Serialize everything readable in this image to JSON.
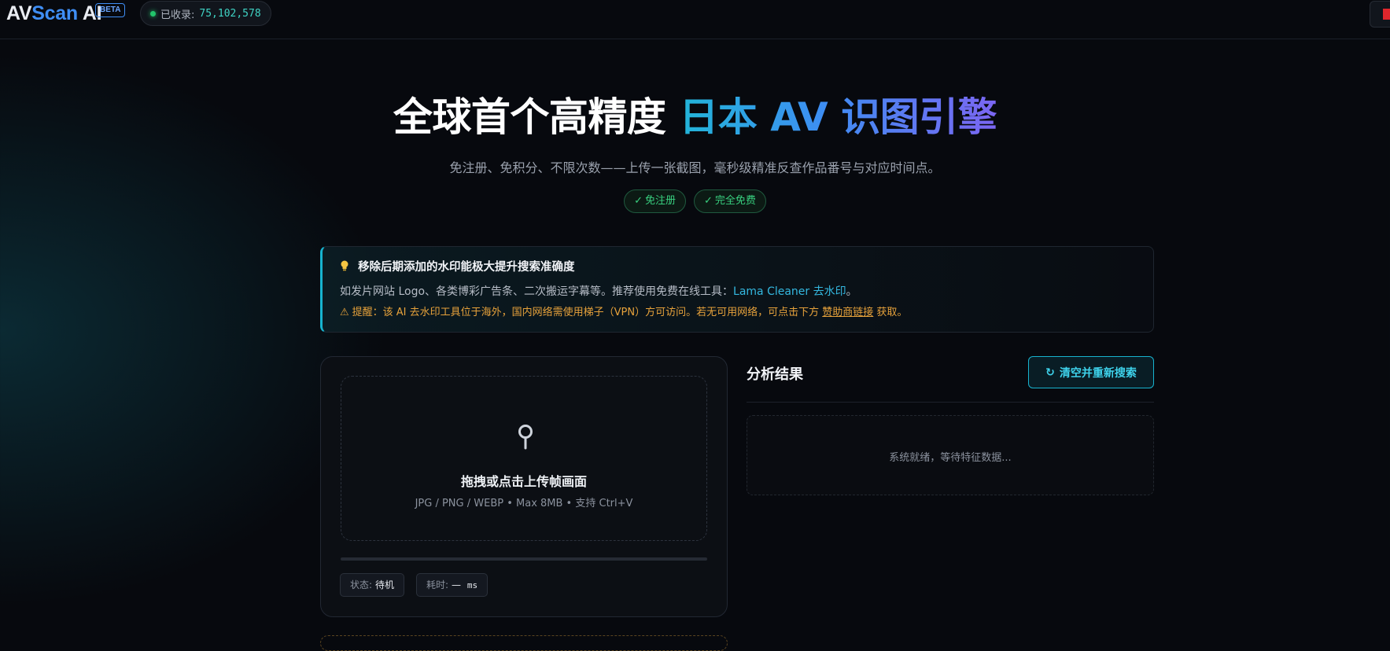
{
  "header": {
    "logo_part1": "AV",
    "logo_part2": "Scan",
    "logo_part3": "AI",
    "beta_badge": "BETA",
    "counter_label": "已收录:",
    "counter_value": "75,102,578",
    "counter_status_color": "#22c56b"
  },
  "hero": {
    "title_plain": "全球首个高精度",
    "title_highlight": "日本 AV 识图引擎",
    "subtitle": "免注册、免积分、不限次数——上传一张截图，毫秒级精准反查作品番号与对应时间点。",
    "pills": [
      {
        "check": "✓",
        "label": "免注册"
      },
      {
        "check": "✓",
        "label": "完全免费"
      }
    ]
  },
  "notice": {
    "title": "移除后期添加的水印能极大提升搜索准确度",
    "line2_text": "如发片网站 Logo、各类博彩广告条、二次搬运字幕等。推荐使用免费在线工具：",
    "line2_link": "Lama Cleaner 去水印",
    "line2_end": "。",
    "warning_icon": "⚠",
    "line3_text": "提醒：该 AI 去水印工具位于海外，国内网络需使用梯子（VPN）方可访问。若无可用网络，可点击下方",
    "line3_link": "赞助商链接",
    "line3_end": "获取。"
  },
  "upload": {
    "icon": "magnifier-icon",
    "title": "拖拽或点击上传帧画面",
    "formats": "JPG / PNG / WEBP • Max 8MB • 支持 Ctrl+V",
    "progress": 0,
    "status_label": "状态:",
    "status_value": "待机",
    "time_label": "耗时:",
    "time_value": "—",
    "time_unit": "ms"
  },
  "results": {
    "title": "分析结果",
    "clear_button_icon": "↻",
    "clear_button": "清空并重新搜索",
    "placeholder": "系统就绪，等待特征数据..."
  },
  "colors": {
    "accent": "#17b3cf",
    "brand_blue": "#3f8ef4",
    "success": "#38d07f",
    "warning": "#e7a23b"
  }
}
